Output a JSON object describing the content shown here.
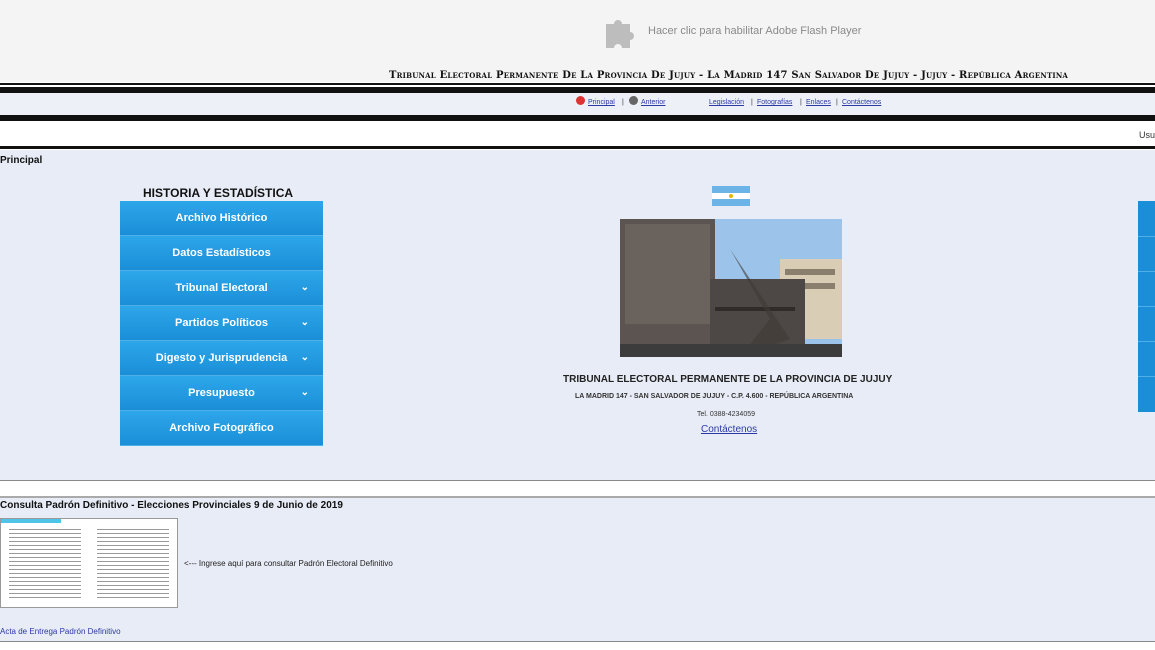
{
  "flash": {
    "text": "Hacer clic para habilitar Adobe Flash Player",
    "icon": "puzzle-icon"
  },
  "header": {
    "title": "Tribunal Electoral Permanente De La Provincia De Jujuy - La Madrid 147 San Salvador De Jujuy - Jujuy - República Argentina"
  },
  "nav": {
    "links": [
      {
        "label": "Principal",
        "icon": "home-icon"
      },
      {
        "label": "Anterior",
        "icon": "back-icon"
      },
      {
        "label": "Legislación"
      },
      {
        "label": "Fotografías"
      },
      {
        "label": "Enlaces"
      },
      {
        "label": "Contáctenos"
      }
    ],
    "separator": "|"
  },
  "userbar": {
    "text": "Usu"
  },
  "main": {
    "title": "Principal",
    "history": {
      "title": "HISTORIA Y ESTADÍSTICA",
      "items": [
        {
          "label": "Archivo Histórico",
          "chevron": ""
        },
        {
          "label": "Datos Estadísticos",
          "chevron": ""
        },
        {
          "label": "Tribunal Electoral",
          "chevron": "⌄"
        },
        {
          "label": "Partidos Políticos",
          "chevron": "⌄"
        },
        {
          "label": "Digesto y Jurisprudencia",
          "chevron": "⌄"
        },
        {
          "label": "Presupuesto",
          "chevron": "⌄"
        },
        {
          "label": "Archivo Fotográfico",
          "chevron": ""
        }
      ]
    },
    "institution": {
      "name": "TRIBUNAL ELECTORAL PERMANENTE DE LA PROVINCIA DE JUJUY",
      "address": "LA MADRID 147 - SAN SALVADOR DE JUJUY - C.P. 4.600 - REPÚBLICA ARGENTINA",
      "phone": "Tel. 0388-4234059",
      "contact": "Contáctenos"
    }
  },
  "padron": {
    "title": "Consulta Padrón Definitivo - Elecciones Provinciales 9 de Junio de 2019",
    "link": "<--- Ingrese aquí para consultar Padrón Electoral Definitivo",
    "acta": "Acta de Entrega Padrón Definitivo"
  },
  "colors": {
    "accent": "#1a8fd8",
    "panel": "#e8ecf6",
    "link": "#2b3aa6"
  }
}
